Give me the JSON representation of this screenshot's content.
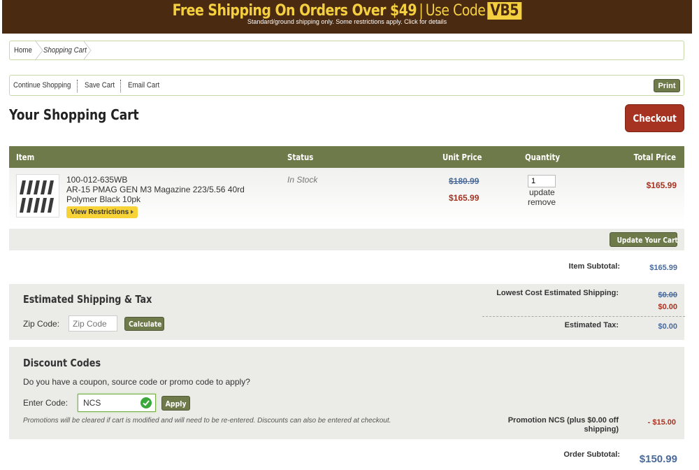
{
  "banner": {
    "headline": "Free Shipping On Orders Over $49",
    "separator": "|",
    "use_code": "Use Code",
    "code": "VB5",
    "subtext": "Standard/ground shipping only. Some restrictions apply. Click for details",
    "bg_color": "#4a2a10",
    "accent_color": "#f4d040"
  },
  "breadcrumb": {
    "home": "Home",
    "current": "Shopping Cart"
  },
  "toolbar": {
    "continue": "Continue Shopping",
    "save": "Save Cart",
    "email": "Email Cart",
    "print": "Print"
  },
  "page": {
    "title": "Your Shopping Cart",
    "checkout": "Checkout"
  },
  "table": {
    "headers": {
      "item": "Item",
      "status": "Status",
      "unit_price": "Unit Price",
      "quantity": "Quantity",
      "total_price": "Total Price"
    },
    "rows": [
      {
        "sku": "100-012-635WB",
        "name": "AR-15 PMAG GEN M3 Magazine 223/5.56 40rd Polymer Black 10pk",
        "restrictions": "View Restrictions",
        "status": "In Stock",
        "old_price": "$180.99",
        "new_price": "$165.99",
        "quantity": "1",
        "update": "update",
        "remove": "remove",
        "total": "$165.99"
      }
    ]
  },
  "update_cart": "Update Your Cart",
  "summary": {
    "item_subtotal_label": "Item Subtotal:",
    "item_subtotal": "$165.99",
    "shipping_label": "Lowest Cost Estimated Shipping:",
    "shipping_old": "$0.00",
    "shipping_new": "$0.00",
    "tax_label": "Estimated Tax:",
    "tax": "$0.00",
    "order_subtotal_label": "Order Subtotal:",
    "order_subtotal": "$150.99"
  },
  "shipping": {
    "title": "Estimated Shipping & Tax",
    "zip_label": "Zip Code:",
    "zip_placeholder": "Zip Code",
    "calculate": "Calculate"
  },
  "discount": {
    "title": "Discount Codes",
    "question": "Do you have a coupon, source code or promo code to apply?",
    "code_label": "Enter Code:",
    "code_value": "NCS",
    "apply": "Apply",
    "note": "Promotions will be cleared if cart is modified and will need to be re-entered. Discounts can also be entered at checkout.",
    "promo_label": "Promotion NCS (plus $0.00 off shipping)",
    "promo_value": "- $15.00"
  },
  "colors": {
    "olive": "#6e7a4a",
    "red": "#a63321",
    "blue": "#4a6a9a",
    "panel": "#ebece8"
  }
}
